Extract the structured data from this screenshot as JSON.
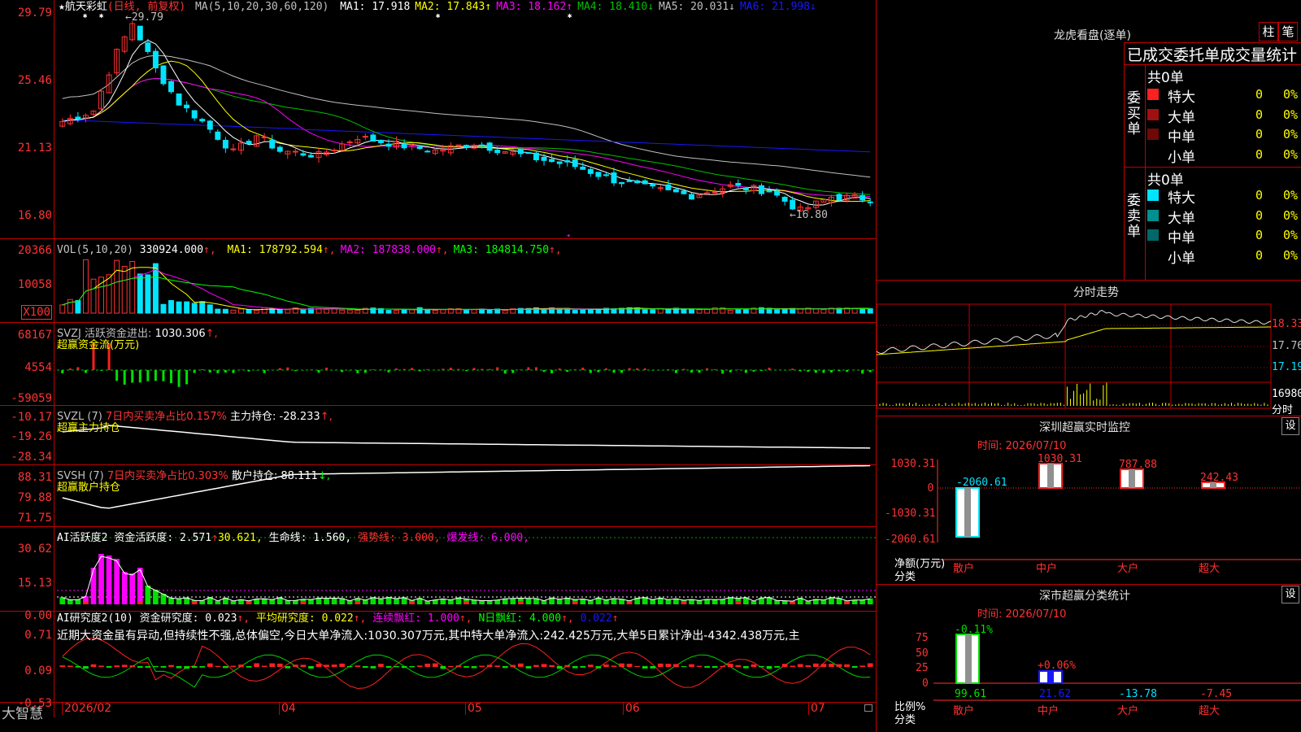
{
  "colors": {
    "up": "#ff3232",
    "down": "#00e4ff",
    "frame": "#c00000",
    "ma1": "#ffffff",
    "ma2": "#ffff00",
    "ma3": "#ff00ff",
    "ma4": "#00c000",
    "ma5": "#c0c0c0",
    "ma6": "#1818ff",
    "green": "#00ff00",
    "yellow": "#ffff00",
    "magenta": "#ff00ff",
    "axis": "#ff3232"
  },
  "main": {
    "stock": "航天彩虹",
    "stock_note": "(日线, 前复权)",
    "ma_lead": "MA(5,10,20,30,60,120)",
    "ma": [
      {
        "k": "MA1:",
        "v": "17.918",
        "a": "",
        "c": "ma1"
      },
      {
        "k": "MA2:",
        "v": "17.843",
        "a": "↑",
        "c": "ma2"
      },
      {
        "k": "MA3:",
        "v": "18.162",
        "a": "↑",
        "c": "ma3"
      },
      {
        "k": "MA4:",
        "v": "18.410",
        "a": "↓",
        "c": "ma4"
      },
      {
        "k": "MA5:",
        "v": "20.031",
        "a": "↓",
        "c": "ma5"
      },
      {
        "k": "MA6:",
        "v": "21.998",
        "a": "↓",
        "c": "ma6"
      }
    ],
    "y_ticks": [
      "29.79",
      "25.46",
      "21.13",
      "16.80"
    ],
    "high_label": "29.79",
    "low_label": "16.80"
  },
  "vol": {
    "lead": "VOL(5,10,20)",
    "v": "330924.000",
    "ma": [
      {
        "k": "MA1:",
        "v": "178792.594",
        "c": "ma2"
      },
      {
        "k": "MA2:",
        "v": "187838.000",
        "c": "ma3"
      },
      {
        "k": "MA3:",
        "v": "184814.750",
        "c": "green"
      }
    ],
    "y_ticks": [
      "20366",
      "10058",
      "X100"
    ]
  },
  "svzj": {
    "lead": "SVZJ",
    "k": "活跃资金进出:",
    "v": "1030.306",
    "arrow": "↑,",
    "title": "超赢资金流(万元)",
    "y_ticks": [
      "68167",
      "4554",
      "-59059"
    ]
  },
  "svzl": {
    "lead": "SVZL (7)",
    "k1": "7日内买卖净占比",
    "v1": "0.157%",
    "k2": "主力持仓:",
    "v2": "-28.233",
    "arrow": "↑,",
    "title": "超赢主力持仓",
    "y_ticks": [
      "-10.17",
      "-19.26",
      "-28.34"
    ]
  },
  "svsh": {
    "lead": "SVSH (7)",
    "k1": "7日内买卖净占比",
    "v1": "0.303%",
    "k2": "散户持仓:",
    "v2": "88.111",
    "arrow": "↓,",
    "title": "超赢散户持仓",
    "y_ticks": [
      "88.31",
      "79.88",
      "71.75"
    ]
  },
  "ai1": {
    "lead": "AI活跃度2",
    "k1": "资金活跃度:",
    "v1": "2.571",
    "v2": "30.621,",
    "k3": "生命线:",
    "v3": "1.560,",
    "k4": "强势线:",
    "v4": "3.000,",
    "k5": "爆发线:",
    "v5": "6.000,",
    "y_ticks": [
      "30.62",
      "15.13",
      "0.00"
    ]
  },
  "ai2": {
    "lead": "AI研究度2(10)",
    "k1": "资金研究度:",
    "v1": "0.023",
    "k2": "平均研究度:",
    "v2": "0.022",
    "k3": "连续飘红:",
    "v3": "1.000",
    "k4": "N日飘红:",
    "v4": "4.000",
    "v5": "0.022",
    "comment": "近期大资金虽有异动,但持续性不强,总体偏空,今日大单净流入:1030.307万元,其中特大单净流入:242.425万元,大单5日累计净出-4342.438万元,主",
    "y_ticks": [
      "0.71",
      "0.09",
      "-0.53"
    ]
  },
  "xaxis": {
    "brand": "大智慧",
    "labels": [
      "2026/02",
      "04",
      "05",
      "06",
      "07"
    ]
  },
  "lhb": {
    "title": "龙虎看盘(逐单)",
    "btn1": "柱",
    "btn2": "笔",
    "header": "已成交委托单成交量统计",
    "buy": {
      "side": "委买单",
      "total": "共0单",
      "rows": [
        {
          "n": "特大",
          "q": "0",
          "p": "0%"
        },
        {
          "n": "大单",
          "q": "0",
          "p": "0%"
        },
        {
          "n": "中单",
          "q": "0",
          "p": "0%"
        },
        {
          "n": "小单",
          "q": "0",
          "p": "0%"
        }
      ]
    },
    "sell": {
      "side": "委卖单",
      "total": "共0单",
      "rows": [
        {
          "n": "特大",
          "q": "0",
          "p": "0%"
        },
        {
          "n": "大单",
          "q": "0",
          "p": "0%"
        },
        {
          "n": "中单",
          "q": "0",
          "p": "0%"
        },
        {
          "n": "小单",
          "q": "0",
          "p": "0%"
        }
      ]
    }
  },
  "fs": {
    "title": "分时走势",
    "p1": "18.33",
    "p2": "17.76",
    "p3": "17.19",
    "vol": "16980",
    "unit": "分时"
  },
  "sz": {
    "title": "深圳超赢实时监控",
    "btn": "设",
    "time": "时间: 2026/07/10",
    "y_ticks": [
      "1030.31",
      "0",
      "-1030.31",
      "-2060.61"
    ],
    "bars": [
      {
        "cat": "散户",
        "v": -2060.61,
        "label": "-2060.61"
      },
      {
        "cat": "中户",
        "v": 1030.31,
        "label": "1030.31"
      },
      {
        "cat": "大户",
        "v": 787.88,
        "label": "787.88"
      },
      {
        "cat": "超大",
        "v": 242.43,
        "label": "242.43"
      }
    ],
    "ylabel1": "净额(万元)",
    "ylabel2": "分类"
  },
  "sc": {
    "title": "深市超赢分类统计",
    "btn": "设",
    "time": "时间: 2026/07/10",
    "y_ticks": [
      "75",
      "50",
      "25",
      "0"
    ],
    "cats": [
      "散户",
      "中户",
      "大户",
      "超大"
    ],
    "bar_labels": [
      "-0.11%",
      "+0.06%"
    ],
    "vals": [
      "99.61",
      "21.62",
      "-13.78",
      "-7.45"
    ],
    "ylabel1": "比例%",
    "ylabel2": "分类"
  }
}
